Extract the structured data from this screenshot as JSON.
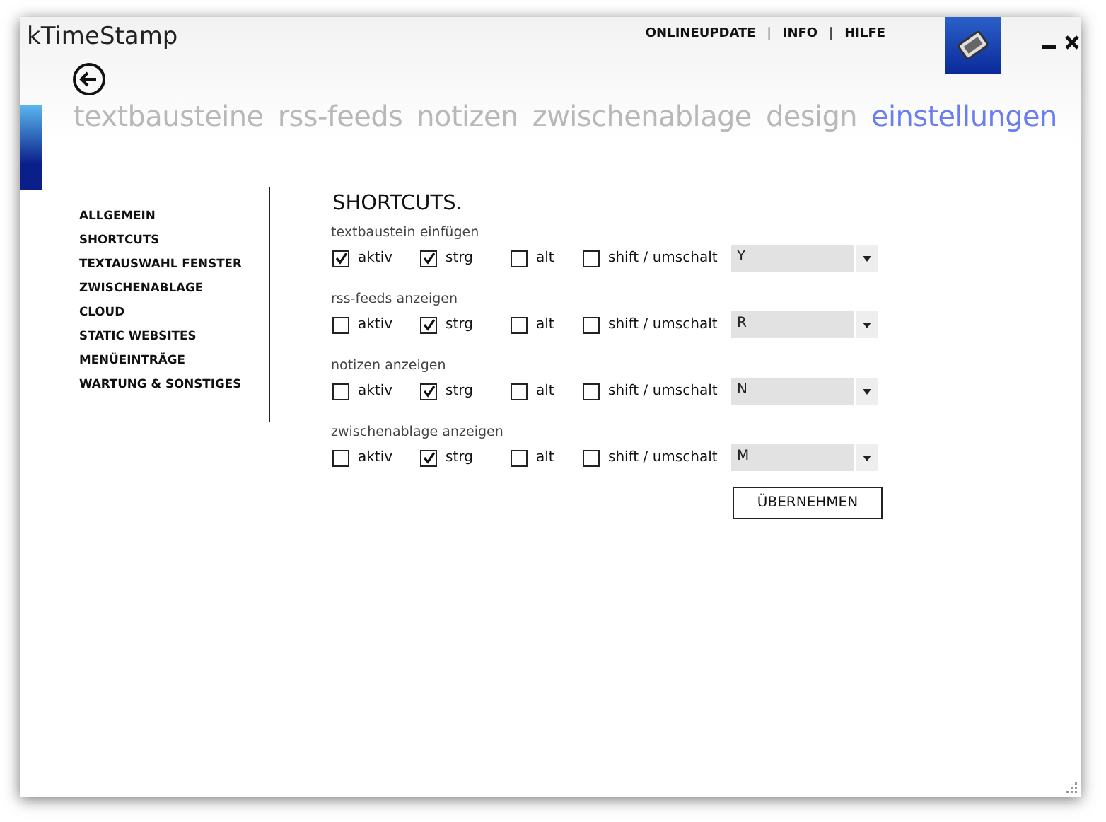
{
  "window": {
    "title": "kTimeStamp"
  },
  "header_links": [
    "ONLINEUPDATE",
    "INFO",
    "HILFE"
  ],
  "header_separators": [
    "|",
    "|"
  ],
  "tabs": [
    {
      "label": "textbausteine",
      "selected": false
    },
    {
      "label": "rss-feeds",
      "selected": false
    },
    {
      "label": "notizen",
      "selected": false
    },
    {
      "label": "zwischenablage",
      "selected": false
    },
    {
      "label": "design",
      "selected": false
    },
    {
      "label": "einstellungen",
      "selected": true
    }
  ],
  "sidebar": {
    "items": [
      "ALLGEMEIN",
      "SHORTCUTS",
      "TEXTAUSWAHL FENSTER",
      "ZWISCHENABLAGE",
      "CLOUD",
      "STATIC WEBSITES",
      "MENÜEINTRÄGE",
      "WARTUNG & SONSTIGES"
    ]
  },
  "heading": "SHORTCUTS.",
  "shortcuts": [
    {
      "label": "textbaustein einfügen",
      "options": [
        {
          "label": "aktiv",
          "checked": true
        },
        {
          "label": "strg",
          "checked": true
        },
        {
          "label": "alt",
          "checked": false
        },
        {
          "label": "shift / umschalt",
          "checked": false
        }
      ],
      "key": "Y"
    },
    {
      "label": "rss-feeds anzeigen",
      "options": [
        {
          "label": "aktiv",
          "checked": false
        },
        {
          "label": "strg",
          "checked": true
        },
        {
          "label": "alt",
          "checked": false
        },
        {
          "label": "shift / umschalt",
          "checked": false
        }
      ],
      "key": "R"
    },
    {
      "label": "notizen anzeigen",
      "options": [
        {
          "label": "aktiv",
          "checked": false
        },
        {
          "label": "strg",
          "checked": true
        },
        {
          "label": "alt",
          "checked": false
        },
        {
          "label": "shift / umschalt",
          "checked": false
        }
      ],
      "key": "N"
    },
    {
      "label": "zwischenablage anzeigen",
      "options": [
        {
          "label": "aktiv",
          "checked": false
        },
        {
          "label": "strg",
          "checked": true
        },
        {
          "label": "alt",
          "checked": false
        },
        {
          "label": "shift / umschalt",
          "checked": false
        }
      ],
      "key": "M"
    }
  ],
  "apply_button": "ÜBERNEHMEN"
}
